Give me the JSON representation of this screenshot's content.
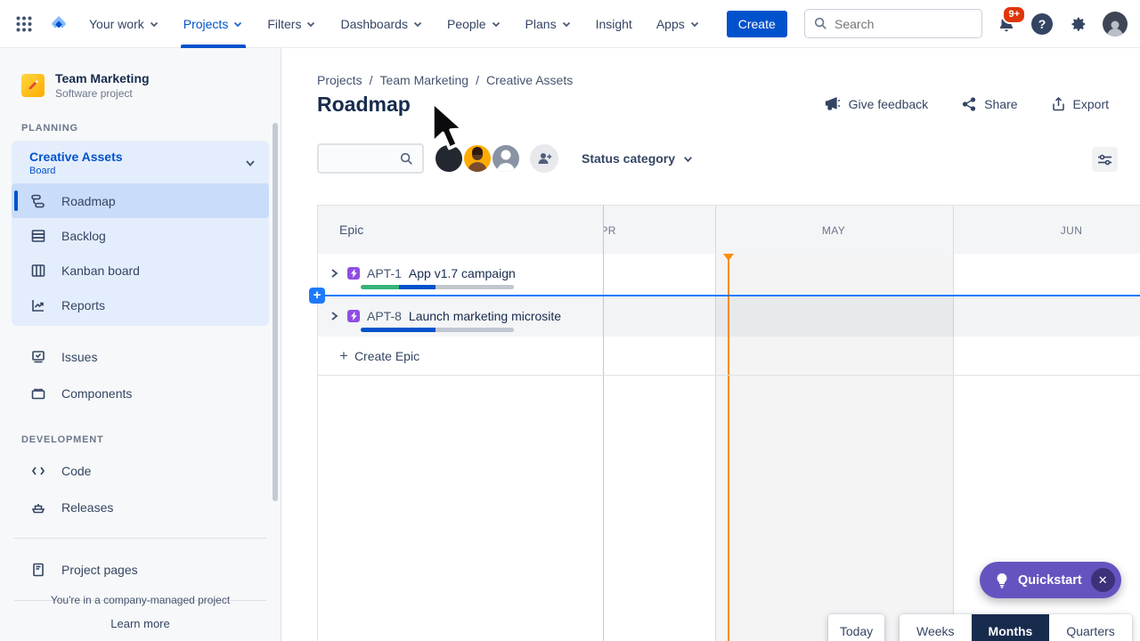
{
  "colors": {
    "accent_blue": "#0052CC",
    "epic_purple": "#904EE2",
    "insertion_blue": "#1D7AFC",
    "today_orange": "#FF8B00",
    "quickstart_purple": "#6554C0",
    "active_unit_navy": "#172B4D",
    "badge_red": "#DE350B"
  },
  "navbar": {
    "items": [
      {
        "label": "Your work"
      },
      {
        "label": "Projects"
      },
      {
        "label": "Filters"
      },
      {
        "label": "Dashboards"
      },
      {
        "label": "People"
      },
      {
        "label": "Plans"
      },
      {
        "label": "Insight"
      },
      {
        "label": "Apps"
      }
    ],
    "create_label": "Create",
    "search_placeholder": "Search",
    "notification_badge": "9+"
  },
  "sidebar": {
    "project": {
      "name": "Team Marketing",
      "type": "Software project"
    },
    "planning_section": "PLANNING",
    "development_section": "DEVELOPMENT",
    "board_group": {
      "name": "Creative Assets",
      "type": "Board"
    },
    "board_items": [
      {
        "label": "Roadmap"
      },
      {
        "label": "Backlog"
      },
      {
        "label": "Kanban board"
      },
      {
        "label": "Reports"
      }
    ],
    "project_items": [
      {
        "label": "Issues"
      },
      {
        "label": "Components"
      }
    ],
    "dev_items": [
      {
        "label": "Code"
      },
      {
        "label": "Releases"
      }
    ],
    "pages_item": "Project pages",
    "footer": {
      "note": "You're in a company-managed project",
      "link": "Learn more"
    }
  },
  "breadcrumb": {
    "items": [
      "Projects",
      "Team Marketing",
      "Creative Assets"
    ],
    "separator": "/"
  },
  "page": {
    "title": "Roadmap"
  },
  "actions": {
    "give_feedback": "Give feedback",
    "share": "Share",
    "export": "Export"
  },
  "toolbar": {
    "status_filter": "Status category"
  },
  "roadmap": {
    "epic_header": "Epic",
    "months": [
      "APR",
      "MAY",
      "JUN"
    ],
    "create_epic": "Create Epic",
    "epics": [
      {
        "key": "APT-1",
        "title": "App v1.7 campaign",
        "progress": [
          {
            "name": "done",
            "color": "#36B37E",
            "pct": 25
          },
          {
            "name": "in-progress",
            "color": "#0052CC",
            "pct": 24
          },
          {
            "name": "todo",
            "color": "#C1C7D0",
            "pct": 51
          }
        ]
      },
      {
        "key": "APT-8",
        "title": "Launch marketing microsite",
        "progress": [
          {
            "name": "in-progress",
            "color": "#0052CC",
            "pct": 49
          },
          {
            "name": "todo",
            "color": "#C1C7D0",
            "pct": 51
          }
        ]
      }
    ]
  },
  "quickstart": {
    "label": "Quickstart"
  },
  "view_controls": {
    "today": "Today",
    "units": [
      "Weeks",
      "Months",
      "Quarters"
    ],
    "active": "Months"
  }
}
